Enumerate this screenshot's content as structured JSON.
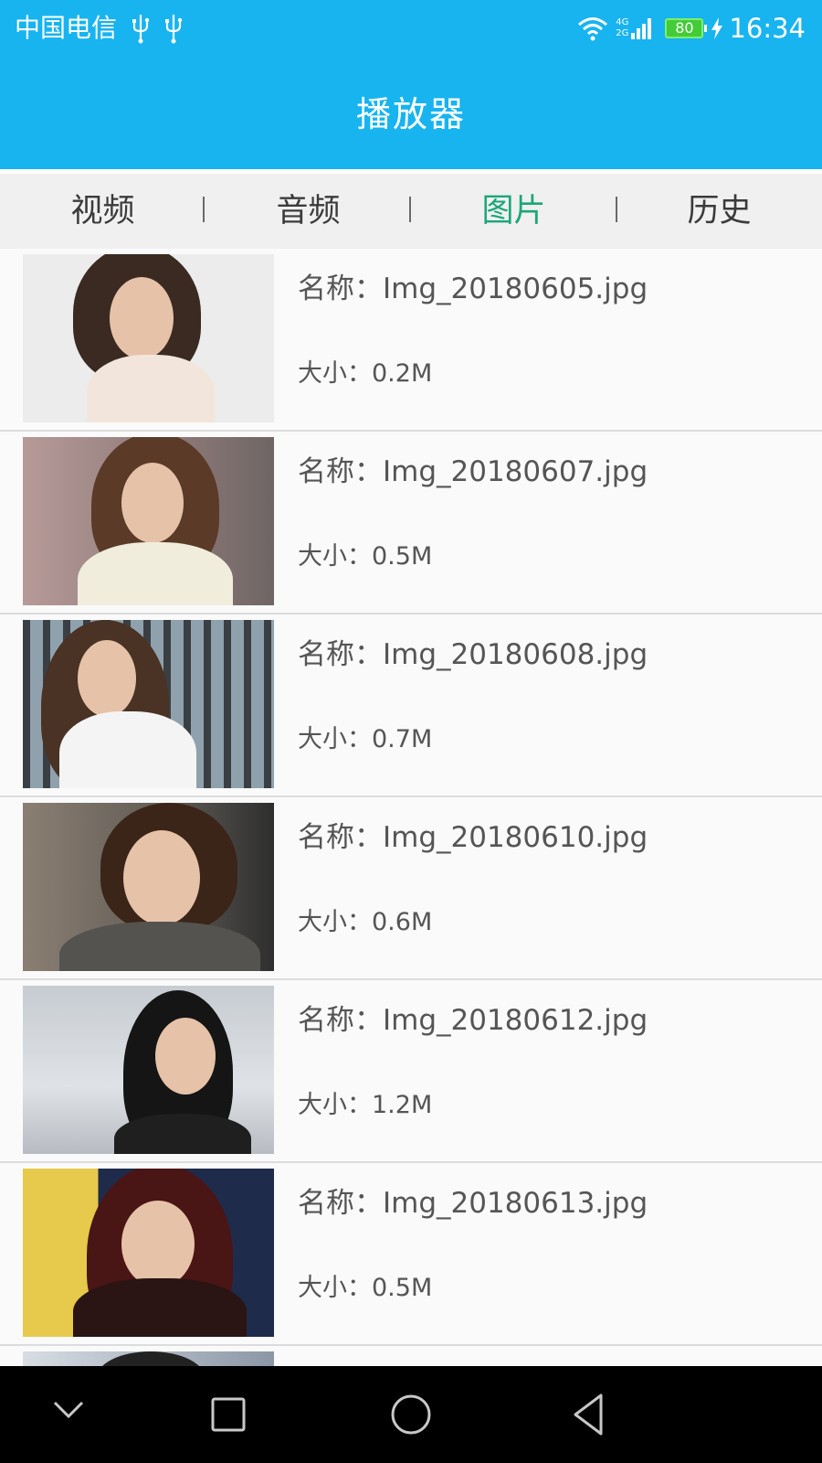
{
  "status_bar": {
    "carrier": "中国电信",
    "network_tags": [
      "4G",
      "2G"
    ],
    "battery_level": "80",
    "time": "16:34",
    "icons": [
      "usb-icon",
      "usb-icon",
      "wifi-icon",
      "signal-icon",
      "battery-icon",
      "charging-icon"
    ]
  },
  "header": {
    "title": "播放器"
  },
  "tabs": [
    {
      "label": "视频",
      "active": false
    },
    {
      "label": "音频",
      "active": false
    },
    {
      "label": "图片",
      "active": true
    },
    {
      "label": "历史",
      "active": false
    }
  ],
  "items": [
    {
      "name": "名称：Img_20180605.jpg",
      "size": "大小：0.2M"
    },
    {
      "name": "名称：Img_20180607.jpg",
      "size": "大小：0.5M"
    },
    {
      "name": "名称：Img_20180608.jpg",
      "size": "大小：0.7M"
    },
    {
      "name": "名称：Img_20180610.jpg",
      "size": "大小：0.6M"
    },
    {
      "name": "名称：Img_20180612.jpg",
      "size": "大小：1.2M"
    },
    {
      "name": "名称：Img_20180613.jpg",
      "size": "大小：0.5M"
    }
  ],
  "nav_bar": {
    "buttons": [
      "chevron-down-icon",
      "square-icon",
      "circle-icon",
      "triangle-back-icon"
    ]
  },
  "colors": {
    "accent": "#17b4f0",
    "active_tab": "#1ba67a"
  }
}
